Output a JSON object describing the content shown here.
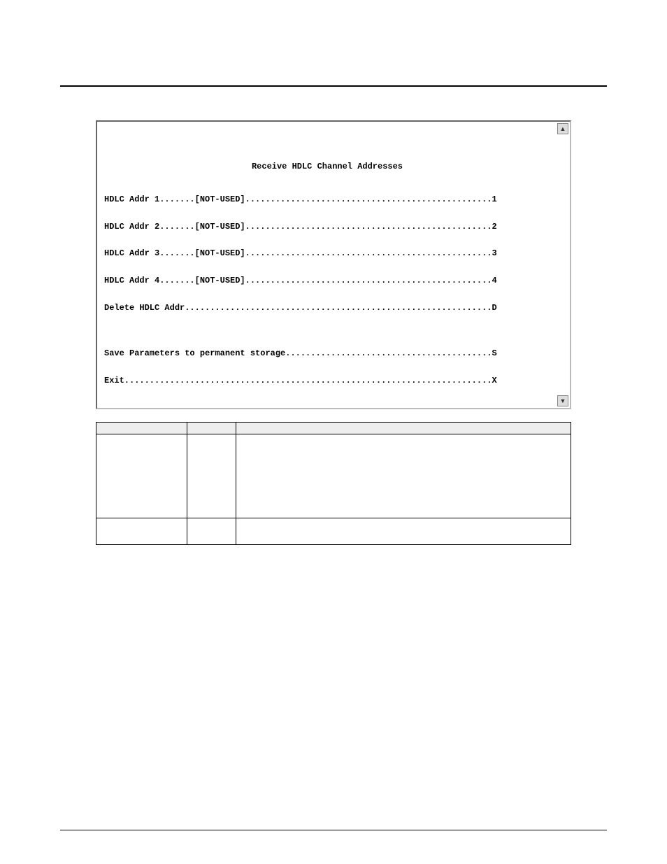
{
  "header": {
    "left": "",
    "right": ""
  },
  "section_label": "",
  "intro_paragraph": "",
  "terminal": {
    "title": "Receive HDLC Channel Addresses",
    "lines": [
      "HDLC Addr 1.......[NOT-USED].................................................1",
      "HDLC Addr 2.......[NOT-USED].................................................2",
      "HDLC Addr 3.......[NOT-USED].................................................3",
      "HDLC Addr 4.......[NOT-USED].................................................4",
      "Delete HDLC Addr.............................................................D",
      "",
      "Save Parameters to permanent storage.........................................S",
      "Exit.........................................................................X"
    ],
    "scroll_up": "▲",
    "scroll_down": "▼"
  },
  "figure_caption": "",
  "table": {
    "headers": [
      "",
      "",
      ""
    ],
    "rows": [
      {
        "option": "",
        "default": "",
        "description": ""
      },
      {
        "option": "",
        "default": "",
        "description": ""
      }
    ]
  },
  "footer": {
    "left": "",
    "right": ""
  }
}
